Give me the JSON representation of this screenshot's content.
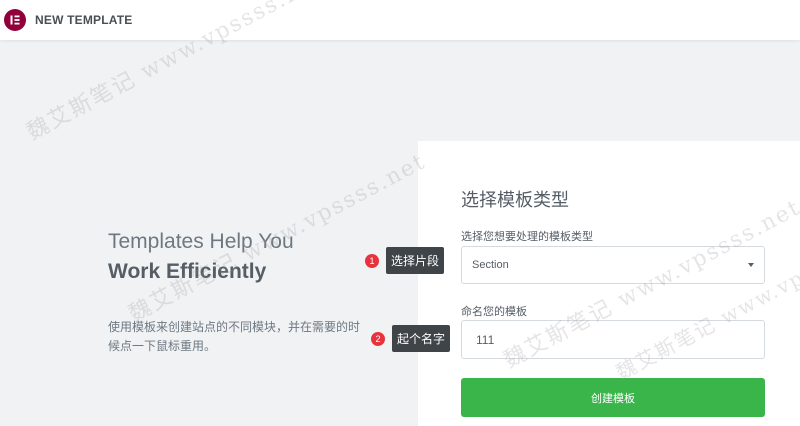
{
  "header": {
    "title": "NEW TEMPLATE",
    "logo_icon": "elementor-logo-icon",
    "logo_color": "#92003b"
  },
  "hero": {
    "line1": "Templates Help You",
    "line2": "Work Efficiently",
    "description": "使用模板来创建站点的不同模块，并在需要的时候点一下鼠标重用。"
  },
  "panel": {
    "title": "选择模板类型",
    "type_label": "选择您想要处理的模板类型",
    "type_value": "Section",
    "name_label": "命名您的模板",
    "name_value": "111",
    "submit_label": "创建模板",
    "submit_color": "#39b54a"
  },
  "annotations": [
    {
      "number": "1",
      "label": "选择片段"
    },
    {
      "number": "2",
      "label": "起个名字"
    }
  ],
  "watermark": "魏艾斯笔记 www.vpssss.net"
}
